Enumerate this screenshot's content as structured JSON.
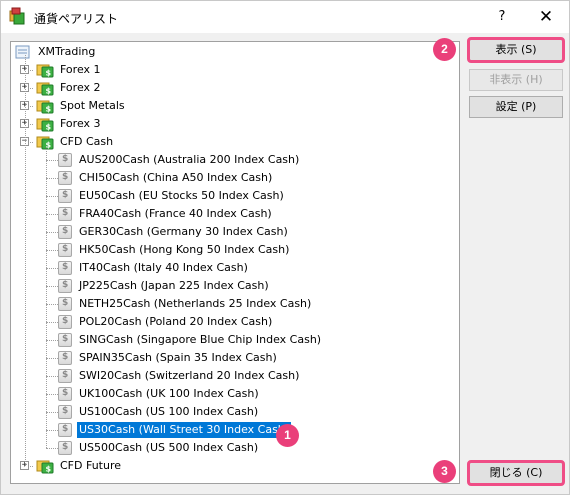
{
  "window": {
    "title": "通貨ペアリスト",
    "help_label": "?",
    "close_label": "✕"
  },
  "tree": {
    "root": "XMTrading",
    "groups": [
      {
        "label": "Forex 1",
        "expanded": false
      },
      {
        "label": "Forex 2",
        "expanded": false
      },
      {
        "label": "Spot Metals",
        "expanded": false
      },
      {
        "label": "Forex 3",
        "expanded": false
      },
      {
        "label": "CFD Cash",
        "expanded": true
      },
      {
        "label": "CFD Future",
        "expanded": false
      }
    ],
    "symbols": [
      {
        "label": "AUS200Cash  (Australia 200 Index Cash)"
      },
      {
        "label": "CHI50Cash  (China A50 Index Cash)"
      },
      {
        "label": "EU50Cash  (EU Stocks 50 Index Cash)"
      },
      {
        "label": "FRA40Cash  (France 40 Index Cash)"
      },
      {
        "label": "GER30Cash  (Germany 30 Index Cash)"
      },
      {
        "label": "HK50Cash  (Hong Kong 50 Index Cash)"
      },
      {
        "label": "IT40Cash  (Italy 40 Index Cash)"
      },
      {
        "label": "JP225Cash  (Japan 225 Index Cash)"
      },
      {
        "label": "NETH25Cash  (Netherlands 25 Index Cash)"
      },
      {
        "label": "POL20Cash  (Poland 20 Index Cash)"
      },
      {
        "label": "SINGCash  (Singapore Blue Chip Index Cash)"
      },
      {
        "label": "SPAIN35Cash  (Spain 35 Index Cash)"
      },
      {
        "label": "SWI20Cash  (Switzerland 20 Index Cash)"
      },
      {
        "label": "UK100Cash  (UK 100 Index Cash)"
      },
      {
        "label": "US100Cash  (US 100 Index Cash)"
      },
      {
        "label": "US30Cash  (Wall Street 30 Index Cash)",
        "selected": true
      },
      {
        "label": "US500Cash  (US 500 Index Cash)"
      }
    ]
  },
  "buttons": {
    "show": "表示 (S)",
    "hide": "非表示 (H)",
    "settings": "設定 (P)",
    "close": "閉じる (C)"
  },
  "annotations": {
    "badge_1": "1",
    "badge_2": "2",
    "badge_3": "3"
  },
  "colors": {
    "selection": "#0078d7",
    "highlight": "#ef4d86",
    "badge": "#ea3f7a"
  }
}
